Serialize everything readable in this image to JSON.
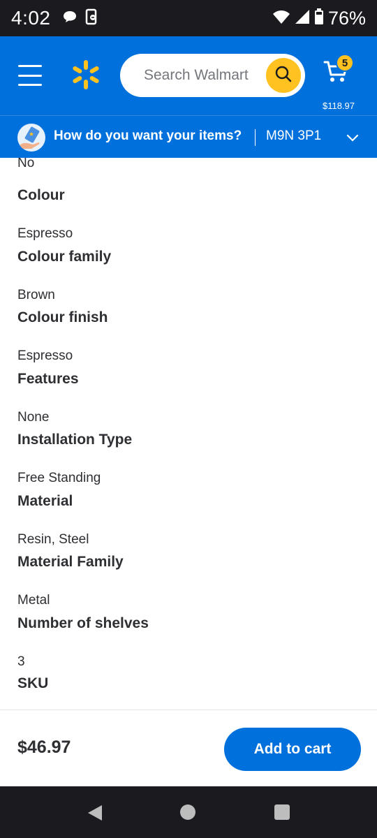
{
  "status_bar": {
    "time": "4:02",
    "battery_percent": "76%"
  },
  "header": {
    "search_placeholder": "Search Walmart",
    "cart_count": "5",
    "cart_total": "$118.97",
    "brand_color": "#0071dc",
    "accent_color": "#ffc220"
  },
  "fulfillment": {
    "question": "How do you want your items?",
    "postal_code": "M9N 3P1"
  },
  "specs": {
    "partial_top_value": "No",
    "items": [
      {
        "label": "Colour",
        "value": "Espresso"
      },
      {
        "label": "Colour family",
        "value": "Brown"
      },
      {
        "label": "Colour finish",
        "value": "Espresso"
      },
      {
        "label": "Features",
        "value": "None"
      },
      {
        "label": "Installation Type",
        "value": "Free Standing"
      },
      {
        "label": "Material",
        "value": "Resin, Steel"
      },
      {
        "label": "Material Family",
        "value": "Metal"
      },
      {
        "label": "Number of shelves",
        "value": "3"
      },
      {
        "label": "SKU",
        "value": ""
      }
    ]
  },
  "action_bar": {
    "price": "$46.97",
    "add_to_cart_label": "Add to cart"
  },
  "icons": {
    "status_left": [
      "chat-bubble-icon",
      "phone-sync-icon"
    ],
    "status_right": [
      "wifi-icon",
      "cellular-signal-icon",
      "battery-icon"
    ],
    "header": [
      "hamburger-menu-icon",
      "walmart-spark-icon",
      "search-icon",
      "cart-icon"
    ],
    "fulfillment": [
      "delivery-hand-icon",
      "chevron-down-icon"
    ],
    "nav": [
      "nav-back-icon",
      "nav-home-icon",
      "nav-recents-icon"
    ]
  }
}
